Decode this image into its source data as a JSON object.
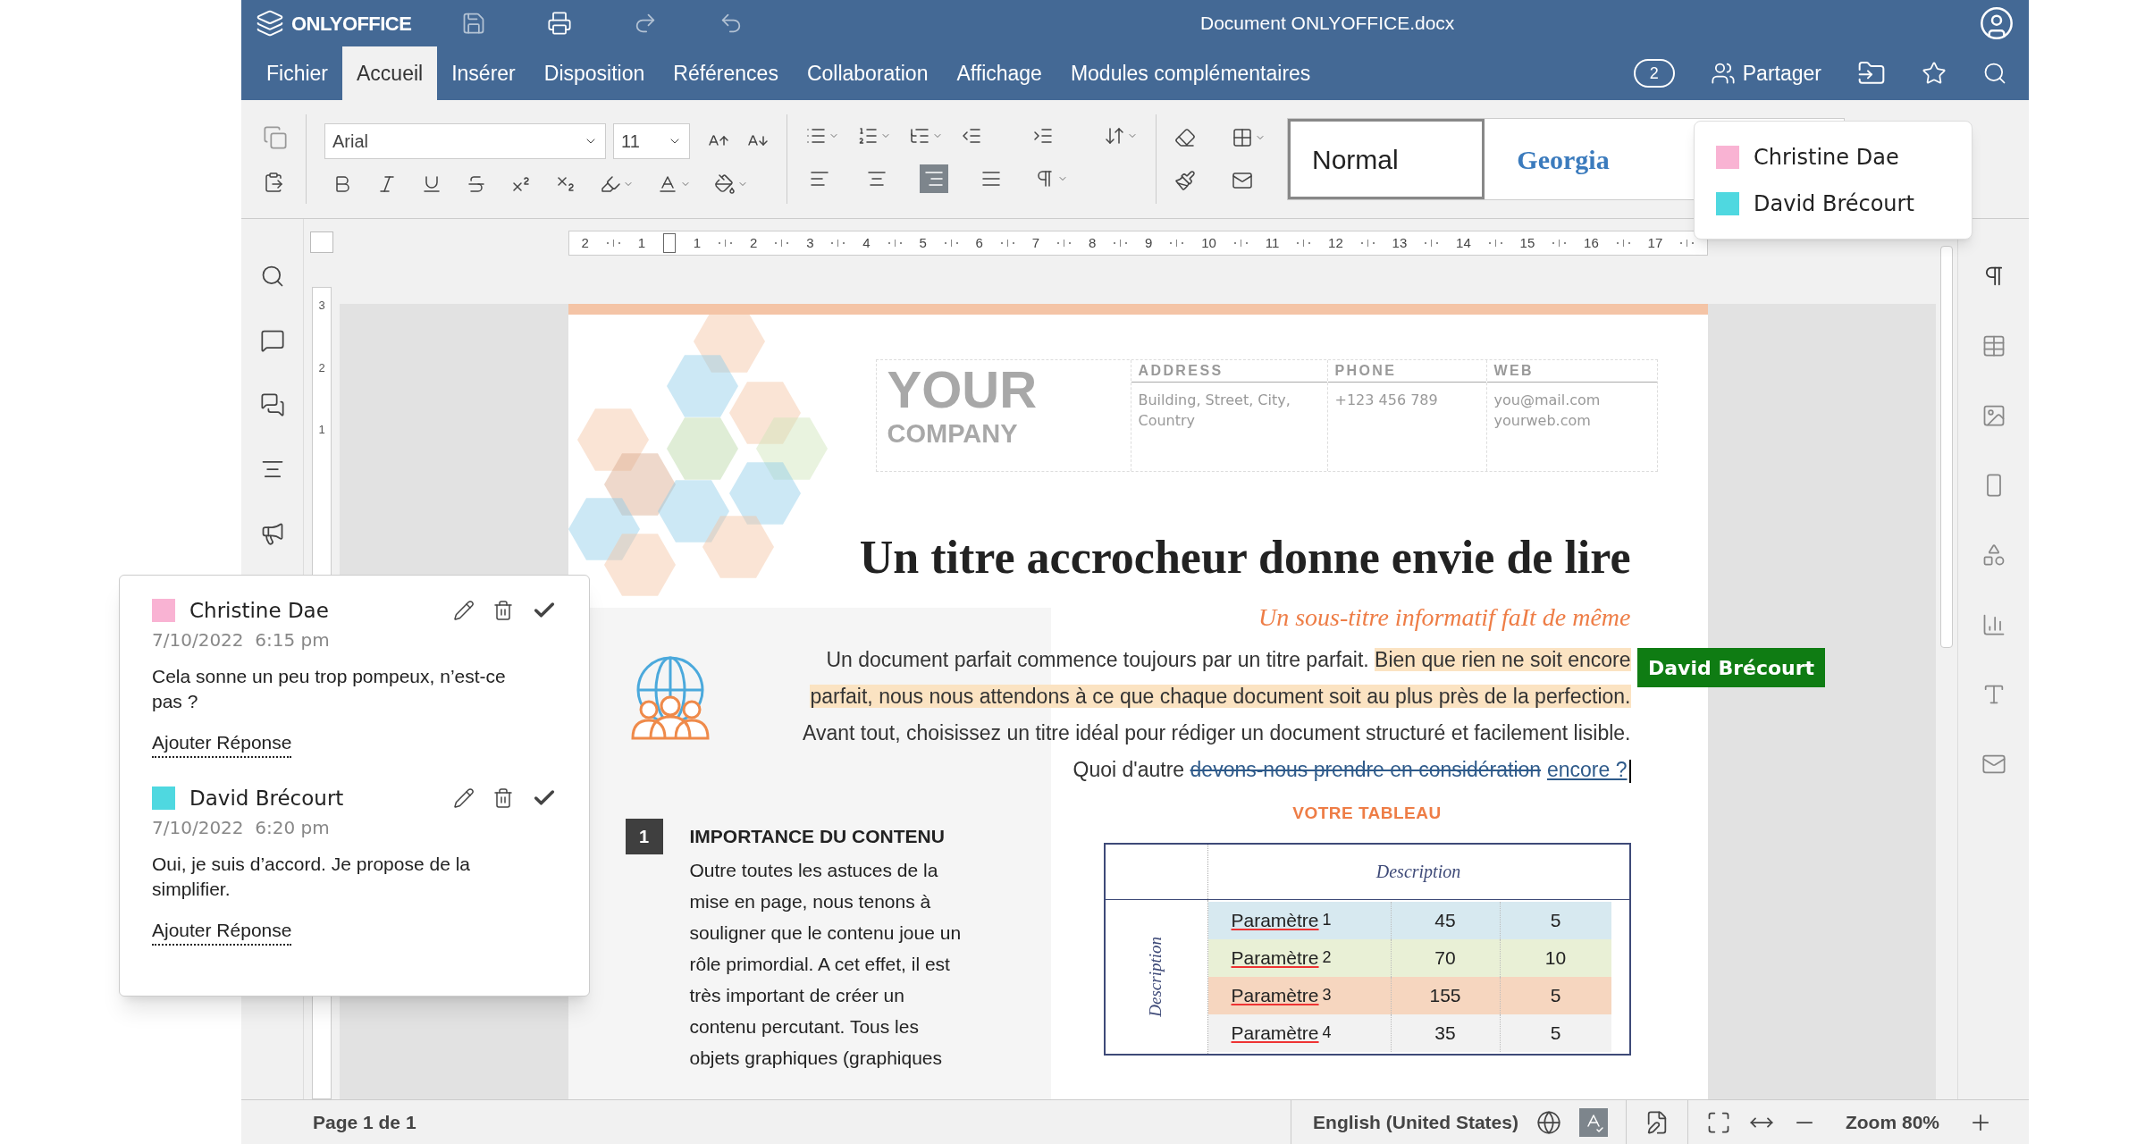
{
  "app": {
    "logo": "ONLYOFFICE",
    "title": "Document ONLYOFFICE.docx"
  },
  "menu_tabs": [
    {
      "label": "Fichier",
      "selected": false
    },
    {
      "label": "Accueil",
      "selected": true
    },
    {
      "label": "Insérer",
      "selected": false
    },
    {
      "label": "Disposition",
      "selected": false
    },
    {
      "label": "Références",
      "selected": false
    },
    {
      "label": "Collaboration",
      "selected": false
    },
    {
      "label": "Affichage",
      "selected": false
    },
    {
      "label": "Modules complémentaires",
      "selected": false
    }
  ],
  "header_actions": {
    "users_count": "2",
    "share": "Partager"
  },
  "toolbar": {
    "font": "Arial",
    "size": "11",
    "alignment": [
      {
        "kind": "left",
        "selected": false
      },
      {
        "kind": "center",
        "selected": false
      },
      {
        "kind": "right",
        "selected": true
      },
      {
        "kind": "justify",
        "selected": false
      }
    ],
    "styles": [
      {
        "label": "Normal",
        "kind": "normal",
        "selected": true
      },
      {
        "label": "Georgia",
        "kind": "heading",
        "selected": false
      }
    ]
  },
  "users_list": [
    {
      "name": "Christine Dae",
      "color": "#f9b3d3"
    },
    {
      "name": "David Brécourt",
      "color": "#4fd8e0"
    }
  ],
  "horizontal_ruler": [
    "2",
    "1",
    "1",
    "2",
    "3",
    "4",
    "5",
    "6",
    "7",
    "8",
    "9",
    "10",
    "11",
    "12",
    "13",
    "14",
    "15",
    "16",
    "17"
  ],
  "vertical_ruler": [
    "3",
    "2",
    "1"
  ],
  "comments": [
    {
      "author": "Christine Dae",
      "color": "#f9b3d3",
      "date": "7/10/2022  6:15 pm",
      "text": "Cela sonne un peu trop pompeux, n’est-ce pas ?",
      "reply": "Ajouter Réponse"
    },
    {
      "author": "David Brécourt",
      "color": "#4fd8e0",
      "date": "7/10/2022  6:20 pm",
      "text": "Oui, je suis d’accord. Je propose de la simplifier.",
      "reply": "Ajouter Réponse"
    }
  ],
  "document": {
    "company": [
      "YOUR",
      "COMPANY"
    ],
    "contacts": [
      {
        "heading": "ADDRESS",
        "lines": [
          "Building, Street, City,",
          "Country"
        ]
      },
      {
        "heading": "PHONE",
        "lines": [
          "+123 456 789"
        ]
      },
      {
        "heading": "WEB",
        "lines": [
          "you@mail.com",
          "yourweb.com"
        ]
      }
    ],
    "title": "Un titre accrocheur donne envie de lire",
    "subtitle": "Un sous-titre informatif faIt de même",
    "paragraph": [
      {
        "kind": "normal",
        "text": "Un document parfait commence toujours par un titre parfait. "
      },
      {
        "kind": "highlight",
        "text": "Bien que rien ne soit encore parfait, nous nous attendons à ce que chaque document soit au plus près de la perfection."
      },
      {
        "kind": "normal",
        "text": " Avant tout, choisissez un titre idéal pour rédiger un document structuré et facilement lisible. Quoi d'autre "
      },
      {
        "kind": "deleted",
        "text": "devons-nous prendre en considération"
      },
      {
        "kind": "inserted",
        "text": "encore ?"
      }
    ],
    "section": {
      "number": "1",
      "heading": "IMPORTANCE DU CONTENU",
      "lines": [
        "Outre toutes les astuces de la",
        "mise en page, nous tenons à",
        "souligner que le contenu joue un",
        "rôle primordial. A cet effet, il est",
        "très important de créer un",
        "contenu percutant. Tous les",
        "objets graphiques (graphiques"
      ]
    },
    "table": {
      "caption": "VOTRE TABLEAU",
      "header": "Description",
      "side_label": "Description",
      "rows": [
        {
          "label": "Paramètre",
          "index": "1",
          "values": [
            "45",
            "5"
          ],
          "color": "#d7e9f0"
        },
        {
          "label": "Paramètre",
          "index": "2",
          "values": [
            "70",
            "10"
          ],
          "color": "#e9f0d6"
        },
        {
          "label": "Paramètre",
          "index": "3",
          "values": [
            "155",
            "5"
          ],
          "color": "#f6d6bf"
        },
        {
          "label": "Paramètre",
          "index": "4",
          "values": [
            "35",
            "5"
          ],
          "color": "#f2f2f2"
        }
      ]
    }
  },
  "cursor_label": "David Brécourt",
  "status_bar": {
    "page": "Page 1 de 1",
    "language": "English (United States)",
    "spellcheck_on": true,
    "zoom": "Zoom 80%"
  }
}
